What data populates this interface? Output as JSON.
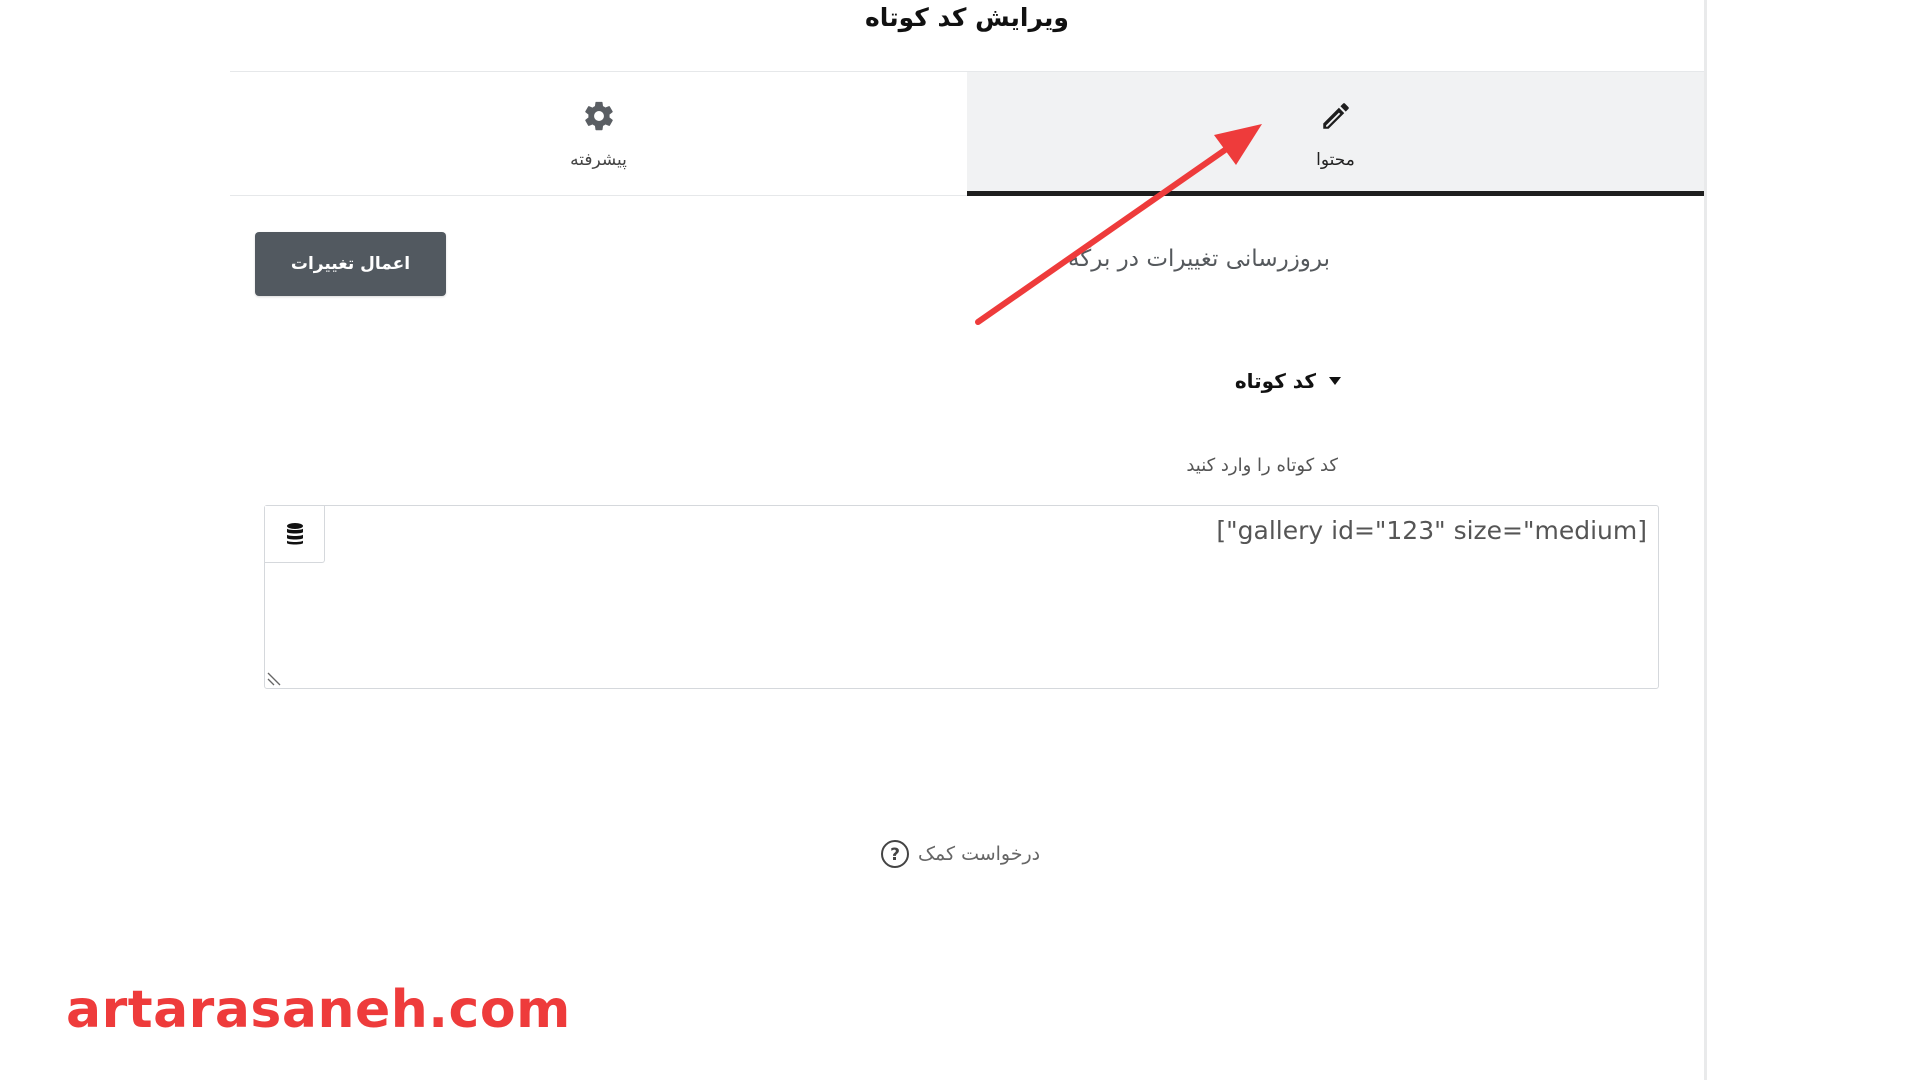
{
  "header": {
    "title": "ویرایش کد کوتاه"
  },
  "tabs": [
    {
      "label": "پیشرفته",
      "icon": "gear-icon",
      "active": false
    },
    {
      "label": "محتوا",
      "icon": "pencil-icon",
      "active": true
    }
  ],
  "content": {
    "update_label": "بروزرسانی تغییرات در برگه",
    "apply_button": "اعمال تغییرات",
    "section_title": "کد کوتاه",
    "field_label": "کد کوتاه را وارد کنید",
    "shortcode_value": "[\"gallery id=\"123\" size=\"medium]"
  },
  "help": {
    "label": "درخواست کمک",
    "icon": "question-circle-icon"
  },
  "watermark": "artarasaneh.com",
  "colors": {
    "apply_button_bg": "#525960",
    "active_tab_bg": "#f1f2f3",
    "annotation_arrow": "#ee3b3b",
    "watermark": "#ee3b3b"
  }
}
